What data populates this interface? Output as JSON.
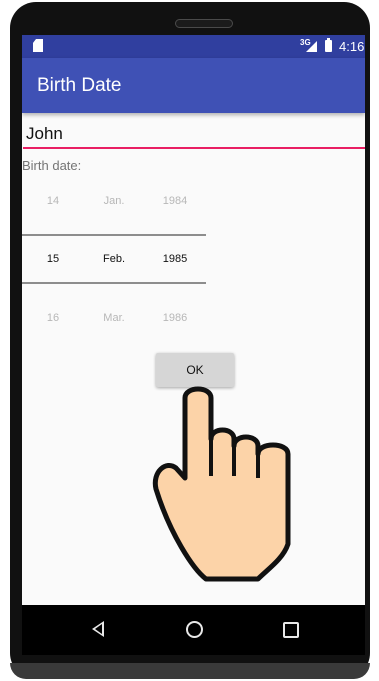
{
  "status_bar": {
    "network": "3G",
    "time": "4:16"
  },
  "app_bar": {
    "title": "Birth Date"
  },
  "form": {
    "name_value": "John",
    "birth_label": "Birth date:"
  },
  "date_picker": {
    "prev_row": {
      "day": "14",
      "month": "Jan.",
      "year": "1984"
    },
    "selected_row": {
      "day": "15",
      "month": "Feb.",
      "year": "1985"
    },
    "next_row": {
      "day": "16",
      "month": "Mar.",
      "year": "1986"
    }
  },
  "ok_button": {
    "label": "OK"
  },
  "nav_bar": {
    "back_icon": "triangle-back",
    "home_icon": "circle-home",
    "recents_icon": "square-recents"
  },
  "colors": {
    "status_bar": "#303f9f",
    "app_bar": "#3f51b5",
    "accent": "#e91e63",
    "hand_fill": "#fcd3a8"
  }
}
